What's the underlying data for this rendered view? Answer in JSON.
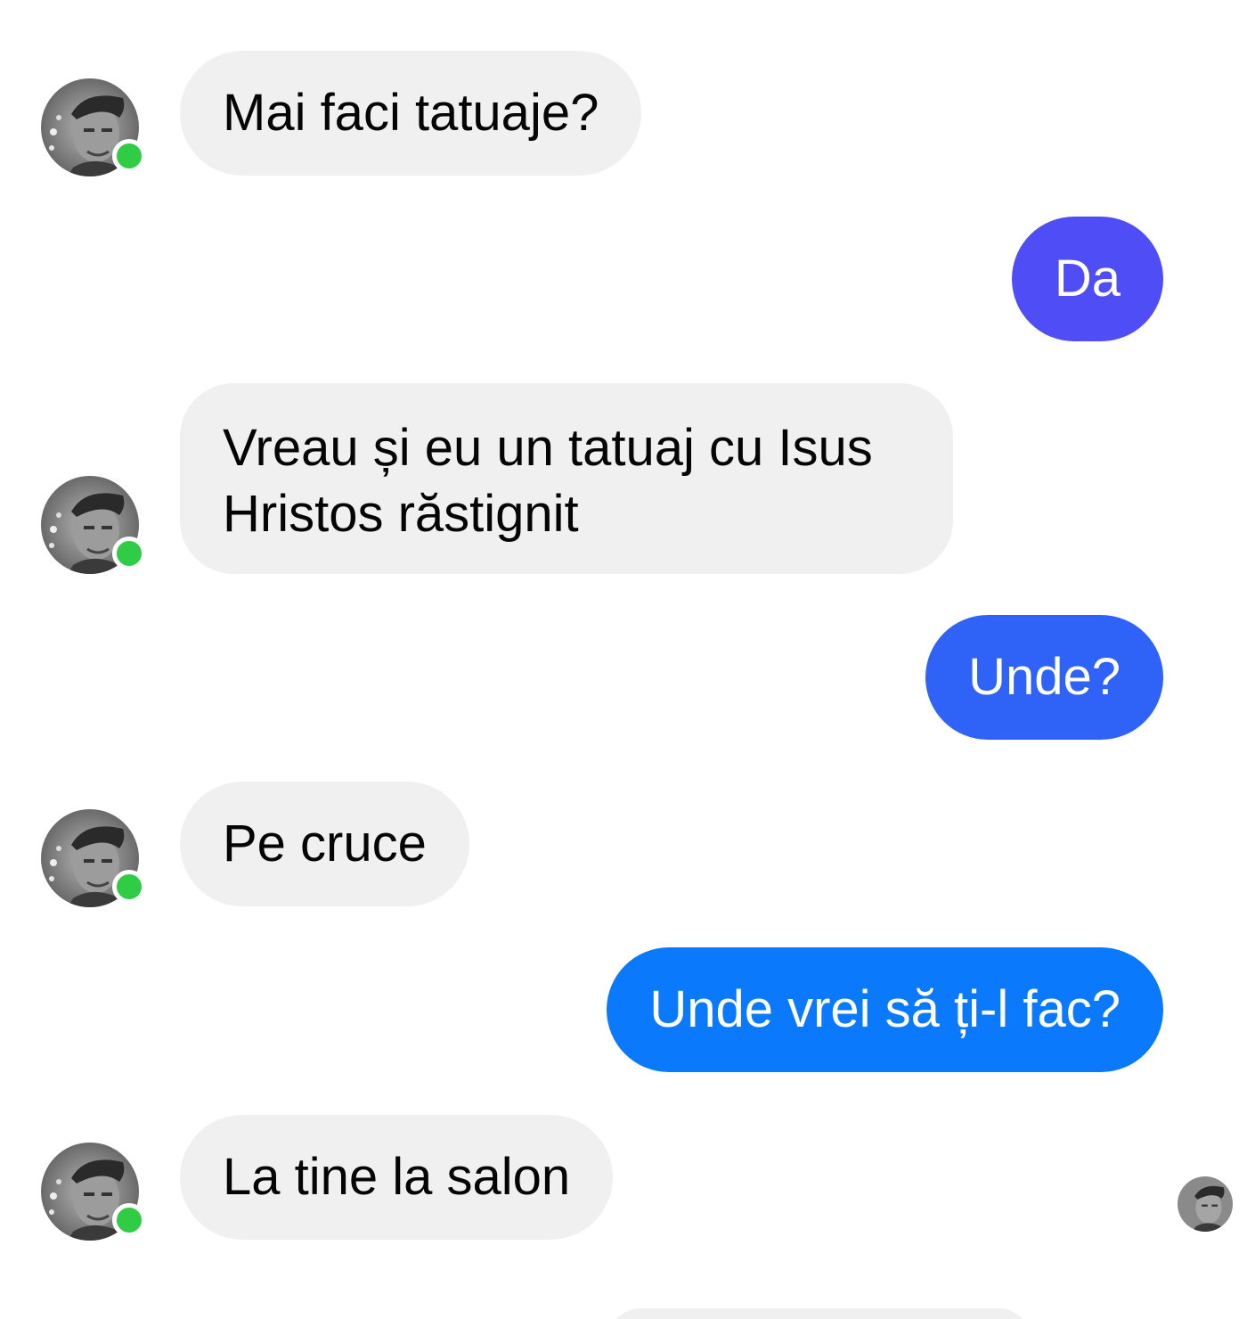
{
  "colors": {
    "incoming_bubble": "#f0f0f0",
    "incoming_text": "#050505",
    "outgoing_text": "#ffffff",
    "online_dot": "#31cc46",
    "outgoing_gradient": [
      "#5b4ef6",
      "#2f6df8",
      "#0a84ff"
    ]
  },
  "contact": {
    "avatar_icon": "person-photo-icon",
    "status": "online"
  },
  "messages": [
    {
      "direction": "in",
      "text": "Mai faci tatuaje?"
    },
    {
      "direction": "out",
      "text": "Da",
      "color": "#4f4df5"
    },
    {
      "direction": "in",
      "text": "Vreau și eu un tatuaj cu Isus\nHristos răstignit"
    },
    {
      "direction": "out",
      "text": "Unde?",
      "color": "#2f62f7"
    },
    {
      "direction": "in",
      "text": "Pe cruce"
    },
    {
      "direction": "out",
      "text": "Unde vrei să ți-l fac?",
      "color": "#0b79fb"
    },
    {
      "direction": "in",
      "text": "La tine la salon"
    }
  ]
}
